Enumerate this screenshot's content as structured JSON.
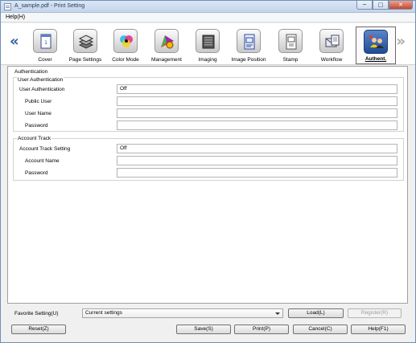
{
  "window": {
    "title": "A_sample.pdf - Print Setting",
    "min": "─",
    "max": "□",
    "close": "✕"
  },
  "menu": {
    "help": "Help(H)"
  },
  "nav": {
    "prev": "«",
    "next": "»",
    "tabs": [
      {
        "label": "Cover",
        "icon": "cover-icon"
      },
      {
        "label": "Page Settings",
        "icon": "page-settings-icon"
      },
      {
        "label": "Color Mode",
        "icon": "color-mode-icon"
      },
      {
        "label": "Management",
        "icon": "management-icon"
      },
      {
        "label": "Imaging",
        "icon": "imaging-icon"
      },
      {
        "label": "Image Position",
        "icon": "image-position-icon"
      },
      {
        "label": "Stamp",
        "icon": "stamp-icon"
      },
      {
        "label": "Workflow",
        "icon": "workflow-icon"
      },
      {
        "label": "Authent.",
        "icon": "authentication-icon",
        "active": true
      }
    ]
  },
  "authentication": {
    "title": "Authentication",
    "user_auth": {
      "title": "User Authentication",
      "fields": [
        {
          "label": "User Authentication",
          "value": "Off"
        },
        {
          "label": "Public User",
          "value": ""
        },
        {
          "label": "User Name",
          "value": ""
        },
        {
          "label": "Password",
          "value": ""
        }
      ]
    },
    "account_track": {
      "title": "Account Track",
      "fields": [
        {
          "label": "Account Track Setting",
          "value": "Off"
        },
        {
          "label": "Account Name",
          "value": ""
        },
        {
          "label": "Password",
          "value": ""
        }
      ]
    }
  },
  "footer": {
    "favorite_label": "Favorite Setting(U)",
    "favorite_value": "Current settings",
    "load": "Load(L)",
    "register": "Register(R)",
    "reset": "Reset(Z)",
    "save": "Save(S)",
    "print": "Print(P)",
    "cancel": "Cancel(C)",
    "help": "Help(F1)"
  },
  "colors": {
    "accent": "#2a5c9f",
    "titlebar": "#c4d5ea",
    "close": "#c7452d"
  }
}
